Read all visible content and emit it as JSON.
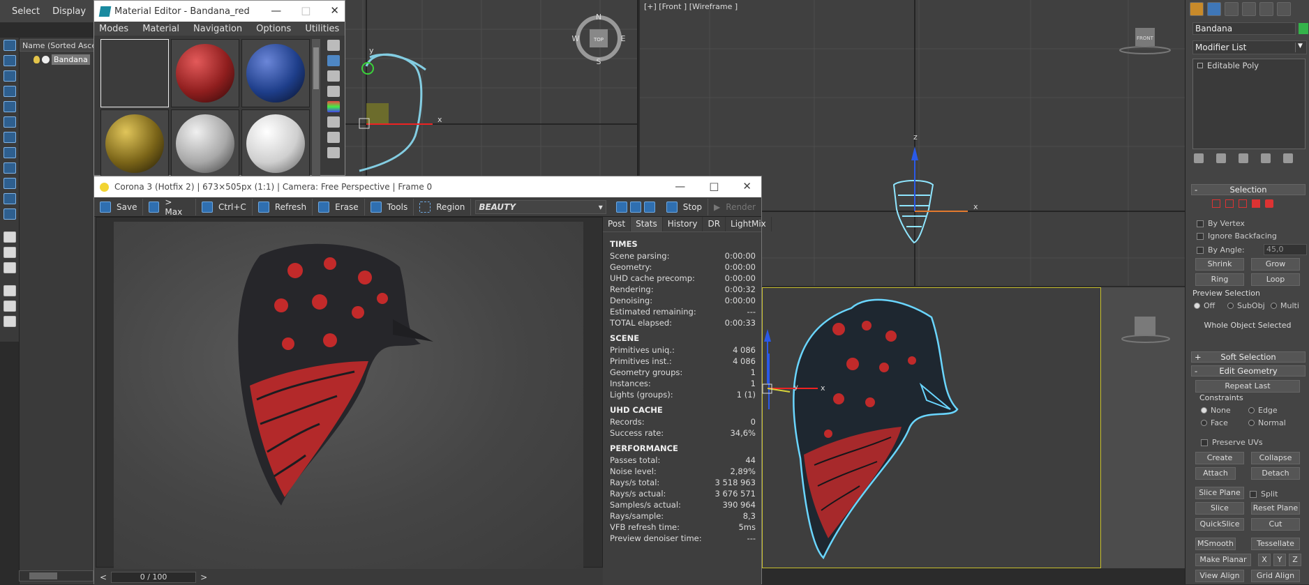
{
  "app": {
    "top_menu": [
      "Select",
      "Display"
    ],
    "scene_explorer": {
      "header": "Name (Sorted Ascen",
      "item": "Bandana"
    }
  },
  "material_editor": {
    "title": "Material Editor - Bandana_red",
    "menu": [
      "Modes",
      "Material",
      "Navigation",
      "Options",
      "Utilities"
    ],
    "slots": [
      {
        "name": "empty-slot",
        "color": "#3c3c3c"
      },
      {
        "name": "bandana-red",
        "color": "#9a2323"
      },
      {
        "name": "bandana-blue",
        "color": "#1e3e8a"
      },
      {
        "name": "bandana-yellow",
        "color": "#a08420"
      },
      {
        "name": "bandana-white",
        "color": "#bdbdbd"
      },
      {
        "name": "plain-white",
        "color": "#dedede"
      }
    ]
  },
  "viewports": {
    "top": {
      "compass": {
        "n": "N",
        "s": "S",
        "e": "E",
        "w": "W",
        "cube": "TOP"
      },
      "axis_x": "x",
      "axis_y": "y"
    },
    "front": {
      "label": "[+] [Front ] [Wireframe ]",
      "cube": "FRONT",
      "axis_x": "x",
      "axis_z": "z"
    },
    "persp": {
      "axis_x": "x",
      "axis_y": "y"
    }
  },
  "vfb": {
    "title": "Corona 3 (Hotfix 2) | 673×505px (1:1) | Camera: Free Perspective | Frame 0",
    "toolbar": {
      "save": "Save",
      "max": "> Max",
      "copy": "Ctrl+C",
      "refresh": "Refresh",
      "erase": "Erase",
      "tools": "Tools",
      "region": "Region",
      "channel": "BEAUTY",
      "stop": "Stop",
      "render": "Render"
    },
    "status": {
      "pass_counter": "0 / 100",
      "prev": "<",
      "next": ">"
    },
    "tabs": [
      "Post",
      "Stats",
      "History",
      "DR",
      "LightMix"
    ],
    "active_tab": "Stats",
    "sections": [
      {
        "title": "TIMES",
        "rows": [
          {
            "label": "Scene parsing:",
            "value": "0:00:00"
          },
          {
            "label": "Geometry:",
            "value": "0:00:00"
          },
          {
            "label": "UHD cache precomp:",
            "value": "0:00:00"
          },
          {
            "label": "Rendering:",
            "value": "0:00:32"
          },
          {
            "label": "Denoising:",
            "value": "0:00:00"
          },
          {
            "label": "Estimated remaining:",
            "value": "---"
          },
          {
            "label": "TOTAL elapsed:",
            "value": "0:00:33"
          }
        ]
      },
      {
        "title": "SCENE",
        "rows": [
          {
            "label": "Primitives uniq.:",
            "value": "4 086"
          },
          {
            "label": "Primitives inst.:",
            "value": "4 086"
          },
          {
            "label": "Geometry groups:",
            "value": "1"
          },
          {
            "label": "Instances:",
            "value": "1"
          },
          {
            "label": "Lights (groups):",
            "value": "1 (1)"
          }
        ]
      },
      {
        "title": "UHD CACHE",
        "rows": [
          {
            "label": "Records:",
            "value": "0"
          },
          {
            "label": "Success rate:",
            "value": "34,6%"
          }
        ]
      },
      {
        "title": "PERFORMANCE",
        "rows": [
          {
            "label": "Passes total:",
            "value": "44"
          },
          {
            "label": "Noise level:",
            "value": "2,89%"
          },
          {
            "label": "Rays/s total:",
            "value": "3 518 963"
          },
          {
            "label": "Rays/s actual:",
            "value": "3 676 571"
          },
          {
            "label": "Samples/s actual:",
            "value": "390 964"
          },
          {
            "label": "Rays/sample:",
            "value": "8,3"
          },
          {
            "label": "VFB refresh time:",
            "value": "5ms"
          },
          {
            "label": "Preview denoiser time:",
            "value": "---"
          }
        ]
      }
    ]
  },
  "command_panel": {
    "object_name": "Bandana",
    "object_color": "#34b34a",
    "modifier_list": "Modifier List",
    "stack_item": "Editable Poly",
    "selection": {
      "title": "Selection",
      "by_vertex": "By Vertex",
      "ignore_backfacing": "Ignore Backfacing",
      "by_angle": "By Angle:",
      "angle_value": "45,0",
      "shrink": "Shrink",
      "grow": "Grow",
      "ring": "Ring",
      "loop": "Loop",
      "preview_title": "Preview Selection",
      "preview_off": "Off",
      "preview_subobj": "SubObj",
      "preview_multi": "Multi",
      "status": "Whole Object Selected"
    },
    "soft_selection": "Soft Selection",
    "edit_geometry": {
      "title": "Edit Geometry",
      "repeat_last": "Repeat Last",
      "constraints": "Constraints",
      "c_none": "None",
      "c_edge": "Edge",
      "c_face": "Face",
      "c_normal": "Normal",
      "preserve_uvs": "Preserve UVs",
      "create": "Create",
      "collapse": "Collapse",
      "attach": "Attach",
      "detach": "Detach",
      "slice_plane": "Slice Plane",
      "split": "Split",
      "slice": "Slice",
      "reset_plane": "Reset Plane",
      "quickslice": "QuickSlice",
      "cut": "Cut",
      "msmooth": "MSmooth",
      "tessellate": "Tessellate",
      "make_planar": "Make Planar",
      "x": "X",
      "y": "Y",
      "z": "Z",
      "view_align": "View Align",
      "grid_align": "Grid Align"
    }
  }
}
